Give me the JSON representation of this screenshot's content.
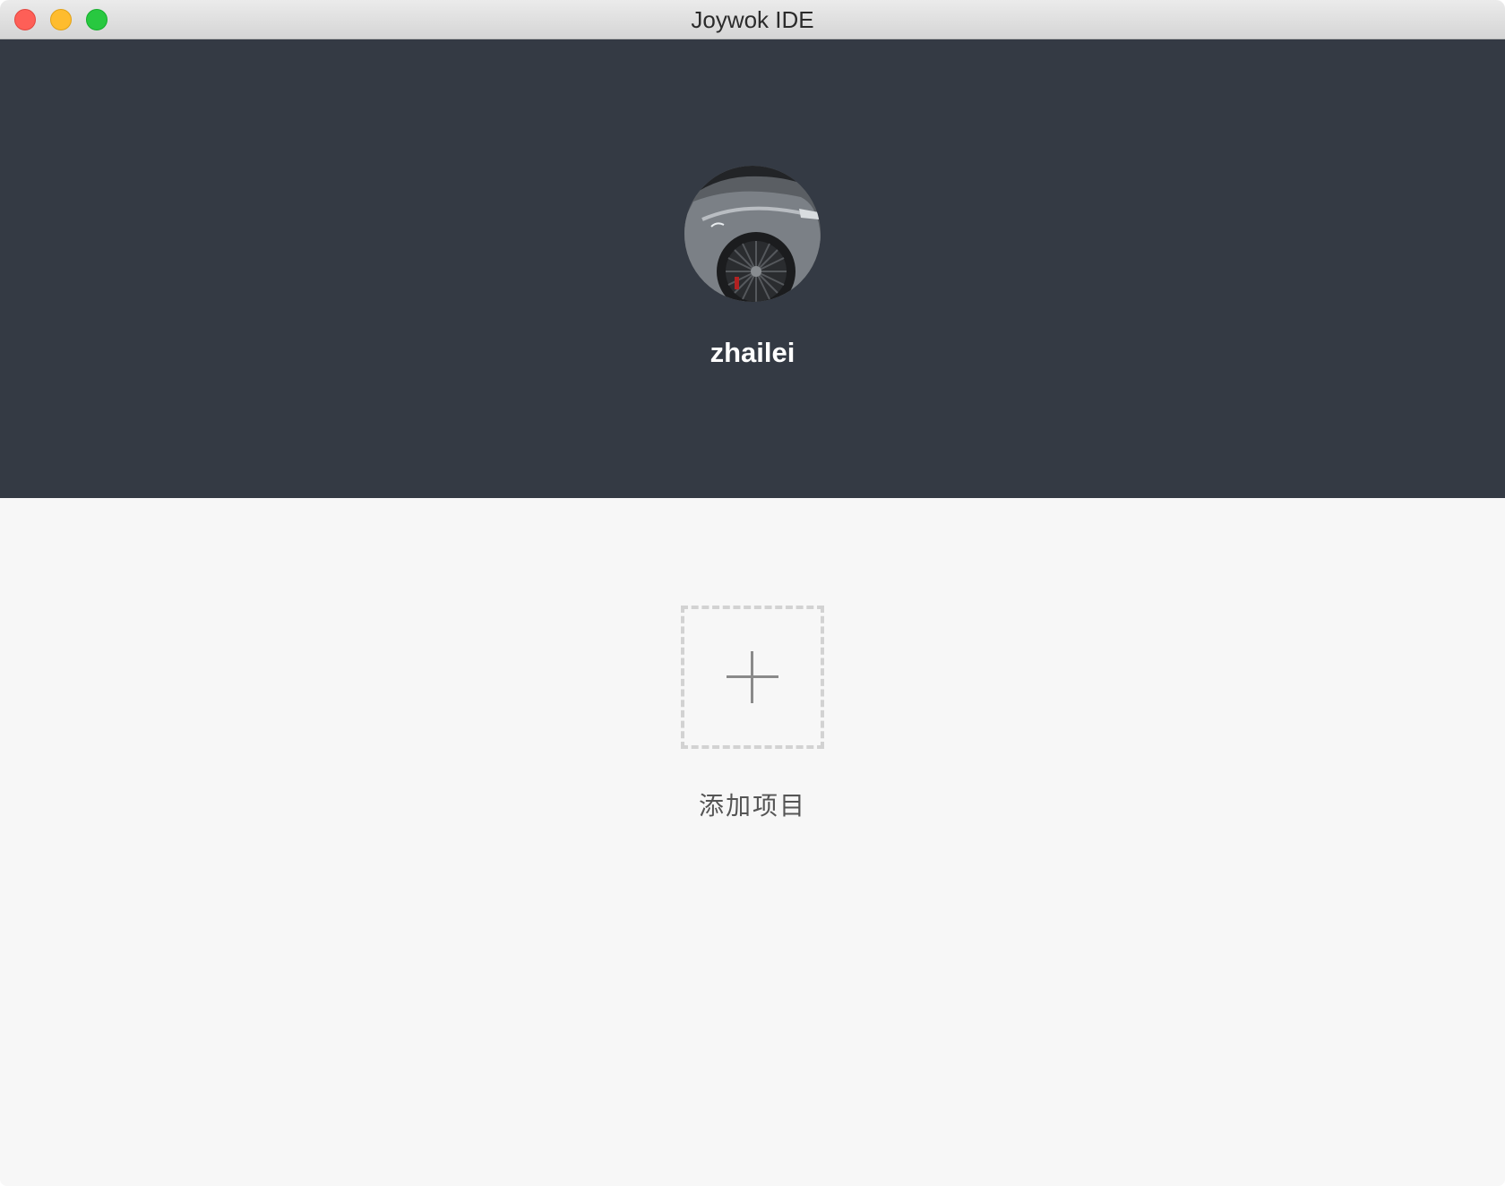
{
  "window": {
    "title": "Joywok IDE",
    "controls": [
      "close-button",
      "minimize-button",
      "zoom-button"
    ]
  },
  "profile": {
    "username": "zhailei",
    "avatar_icon": "user-avatar"
  },
  "main": {
    "add_project_label": "添加项目",
    "add_icon": "plus-icon"
  },
  "colors": {
    "header_bg": "#343a44",
    "body_bg": "#f7f7f7",
    "close": "#fe5f57",
    "minimize": "#febc2e",
    "zoom": "#28c840"
  }
}
